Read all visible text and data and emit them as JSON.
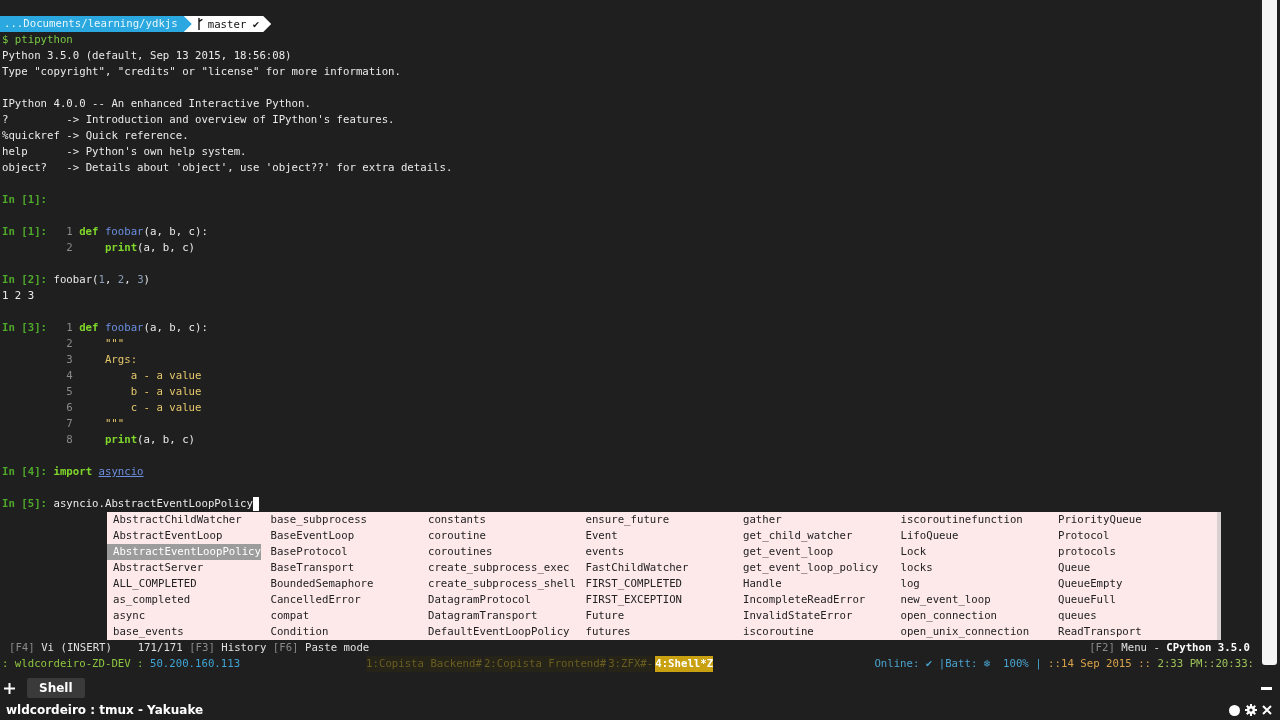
{
  "prompt_bar": {
    "path": "...Documents/learning/ydkjs",
    "branch": "master",
    "status": "✔"
  },
  "lines": [
    {
      "kind": "output",
      "segments": [
        {
          "kind": "shell",
          "text": "$ ptipython"
        }
      ]
    },
    {
      "kind": "output",
      "segments": [
        {
          "kind": "plain",
          "text": "Python 3.5.0 (default, Sep 13 2015, 18:56:08)"
        }
      ]
    },
    {
      "kind": "output",
      "segments": [
        {
          "kind": "plain",
          "text": "Type \"copyright\", \"credits\" or \"license\" for more information."
        }
      ]
    },
    {
      "kind": "blank"
    },
    {
      "kind": "output",
      "segments": [
        {
          "kind": "plain",
          "text": "IPython 4.0.0 -- An enhanced Interactive Python."
        }
      ]
    },
    {
      "kind": "output",
      "segments": [
        {
          "kind": "plain",
          "text": "?         -> Introduction and overview of IPython's features."
        }
      ]
    },
    {
      "kind": "output",
      "segments": [
        {
          "kind": "plain",
          "text": "%quickref -> Quick reference."
        }
      ]
    },
    {
      "kind": "output",
      "segments": [
        {
          "kind": "plain",
          "text": "help      -> Python's own help system."
        }
      ]
    },
    {
      "kind": "output",
      "segments": [
        {
          "kind": "plain",
          "text": "object?   -> Details about 'object', use 'object??' for extra details."
        }
      ]
    },
    {
      "kind": "blank"
    },
    {
      "kind": "input",
      "prompt": "In [1]:"
    },
    {
      "kind": "blank"
    },
    {
      "kind": "input",
      "prompt": "In [1]:",
      "line_no": "1",
      "segments": [
        {
          "kind": "keyword",
          "text": "def "
        },
        {
          "kind": "name",
          "text": "foobar"
        },
        {
          "kind": "plain",
          "text": "(a, b, c):"
        }
      ]
    },
    {
      "kind": "input",
      "line_no": "2",
      "segments": [
        {
          "kind": "keyword",
          "text": "    print"
        },
        {
          "kind": "plain",
          "text": "(a, b, c)"
        }
      ]
    },
    {
      "kind": "blank"
    },
    {
      "kind": "input",
      "prompt": "In [2]:",
      "segments": [
        {
          "kind": "plain",
          "text": "foobar("
        },
        {
          "kind": "number",
          "text": "1"
        },
        {
          "kind": "plain",
          "text": ", "
        },
        {
          "kind": "number",
          "text": "2"
        },
        {
          "kind": "plain",
          "text": ", "
        },
        {
          "kind": "number",
          "text": "3"
        },
        {
          "kind": "plain",
          "text": ")"
        }
      ]
    },
    {
      "kind": "output",
      "segments": [
        {
          "kind": "plain",
          "text": "1 2 3"
        }
      ]
    },
    {
      "kind": "blank"
    },
    {
      "kind": "input",
      "prompt": "In [3]:",
      "line_no": "1",
      "segments": [
        {
          "kind": "keyword",
          "text": "def "
        },
        {
          "kind": "name",
          "text": "foobar"
        },
        {
          "kind": "plain",
          "text": "(a, b, c):"
        }
      ]
    },
    {
      "kind": "input",
      "line_no": "2",
      "segments": [
        {
          "kind": "string",
          "text": "    \"\"\""
        }
      ]
    },
    {
      "kind": "input",
      "line_no": "3",
      "segments": [
        {
          "kind": "string",
          "text": "    Args:"
        }
      ]
    },
    {
      "kind": "input",
      "line_no": "4",
      "segments": [
        {
          "kind": "string",
          "text": "        a - a value"
        }
      ]
    },
    {
      "kind": "input",
      "line_no": "5",
      "segments": [
        {
          "kind": "string",
          "text": "        b - a value"
        }
      ]
    },
    {
      "kind": "input",
      "line_no": "6",
      "segments": [
        {
          "kind": "string",
          "text": "        c - a value"
        }
      ]
    },
    {
      "kind": "input",
      "line_no": "7",
      "segments": [
        {
          "kind": "string",
          "text": "    \"\"\""
        }
      ]
    },
    {
      "kind": "input",
      "line_no": "8",
      "segments": [
        {
          "kind": "keyword",
          "text": "    print"
        },
        {
          "kind": "plain",
          "text": "(a, b, c)"
        }
      ]
    },
    {
      "kind": "blank"
    },
    {
      "kind": "input",
      "prompt": "In [4]:",
      "segments": [
        {
          "kind": "keyword",
          "text": "import "
        },
        {
          "kind": "module",
          "text": "asyncio"
        }
      ]
    },
    {
      "kind": "blank"
    },
    {
      "kind": "input",
      "prompt": "In [5]:",
      "cursor": true,
      "segments": [
        {
          "kind": "plain",
          "text": "asyncio.AbstractEventLoopPolicy"
        }
      ]
    }
  ],
  "completions": [
    [
      {
        "text": "AbstractChildWatcher",
        "selected": false
      },
      {
        "text": "AbstractEventLoop",
        "selected": false
      },
      {
        "text": "AbstractEventLoopPolicy",
        "selected": true
      },
      {
        "text": "AbstractServer",
        "selected": false
      },
      {
        "text": "ALL_COMPLETED",
        "selected": false
      },
      {
        "text": "as_completed",
        "selected": false
      },
      {
        "text": "async",
        "selected": false
      },
      {
        "text": "base_events",
        "selected": false
      }
    ],
    [
      {
        "text": "base_subprocess",
        "selected": false
      },
      {
        "text": "BaseEventLoop",
        "selected": false
      },
      {
        "text": "BaseProtocol",
        "selected": false
      },
      {
        "text": "BaseTransport",
        "selected": false
      },
      {
        "text": "BoundedSemaphore",
        "selected": false
      },
      {
        "text": "CancelledError",
        "selected": false
      },
      {
        "text": "compat",
        "selected": false
      },
      {
        "text": "Condition",
        "selected": false
      }
    ],
    [
      {
        "text": "constants",
        "selected": false
      },
      {
        "text": "coroutine",
        "selected": false
      },
      {
        "text": "coroutines",
        "selected": false
      },
      {
        "text": "create_subprocess_exec",
        "selected": false
      },
      {
        "text": "create_subprocess_shell",
        "selected": false
      },
      {
        "text": "DatagramProtocol",
        "selected": false
      },
      {
        "text": "DatagramTransport",
        "selected": false
      },
      {
        "text": "DefaultEventLoopPolicy",
        "selected": false
      }
    ],
    [
      {
        "text": "ensure_future",
        "selected": false
      },
      {
        "text": "Event",
        "selected": false
      },
      {
        "text": "events",
        "selected": false
      },
      {
        "text": "FastChildWatcher",
        "selected": false
      },
      {
        "text": "FIRST_COMPLETED",
        "selected": false
      },
      {
        "text": "FIRST_EXCEPTION",
        "selected": false
      },
      {
        "text": "Future",
        "selected": false
      },
      {
        "text": "futures",
        "selected": false
      }
    ],
    [
      {
        "text": "gather",
        "selected": false
      },
      {
        "text": "get_child_watcher",
        "selected": false
      },
      {
        "text": "get_event_loop",
        "selected": false
      },
      {
        "text": "get_event_loop_policy",
        "selected": false
      },
      {
        "text": "Handle",
        "selected": false
      },
      {
        "text": "IncompleteReadError",
        "selected": false
      },
      {
        "text": "InvalidStateError",
        "selected": false
      },
      {
        "text": "iscoroutine",
        "selected": false
      }
    ],
    [
      {
        "text": "iscoroutinefunction",
        "selected": false
      },
      {
        "text": "LifoQueue",
        "selected": false
      },
      {
        "text": "Lock",
        "selected": false
      },
      {
        "text": "locks",
        "selected": false
      },
      {
        "text": "log",
        "selected": false
      },
      {
        "text": "new_event_loop",
        "selected": false
      },
      {
        "text": "open_connection",
        "selected": false
      },
      {
        "text": "open_unix_connection",
        "selected": false
      }
    ],
    [
      {
        "text": "PriorityQueue",
        "selected": false
      },
      {
        "text": "Protocol",
        "selected": false
      },
      {
        "text": "protocols",
        "selected": false
      },
      {
        "text": "Queue",
        "selected": false
      },
      {
        "text": "QueueEmpty",
        "selected": false
      },
      {
        "text": "QueueFull",
        "selected": false
      },
      {
        "text": "queues",
        "selected": false
      },
      {
        "text": "ReadTransport",
        "selected": false
      }
    ]
  ],
  "toolbar": {
    "left": [
      {
        "kind": "key",
        "text": "[F4]"
      },
      {
        "kind": "label",
        "text": "Vi (INSERT)"
      },
      {
        "kind": "count",
        "text": "171/171"
      },
      {
        "kind": "key",
        "text": "[F3]"
      },
      {
        "kind": "label",
        "text": "History"
      },
      {
        "kind": "key",
        "text": "[F6]"
      },
      {
        "kind": "label",
        "text": "Paste mode"
      }
    ],
    "right": [
      {
        "kind": "key",
        "text": "[F2]"
      },
      {
        "kind": "label",
        "text": "Menu -"
      },
      {
        "kind": "strong",
        "text": "CPython 3.5.0"
      }
    ]
  },
  "tmux": {
    "session": ": wldcordeiro-ZD-DEV :",
    "ip": "50.200.160.113",
    "windows": [
      {
        "text": "1:Copista Backend#",
        "selected": false
      },
      {
        "text": "2:Copista Frontend#",
        "selected": false
      },
      {
        "text": "3:ZFX#-",
        "selected": false
      },
      {
        "text": "4:Shell*Z",
        "selected": true
      }
    ],
    "status": [
      {
        "kind": "info",
        "text": "Online: ✔"
      },
      {
        "kind": "info",
        "text": "|Batt: ❄  100% |"
      },
      {
        "kind": "date",
        "text": "::14 Sep 2015 ::"
      },
      {
        "kind": "time",
        "text": " 2:33 PM::20:33:"
      }
    ]
  },
  "tabs": [
    {
      "label": "Shell",
      "selected": true
    }
  ],
  "title": "wldcordeiro : tmux - Yakuake"
}
